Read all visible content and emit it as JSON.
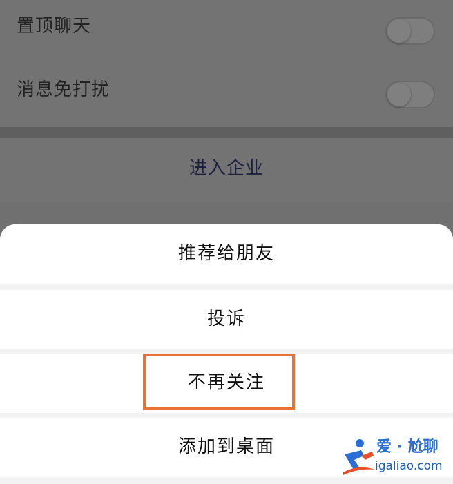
{
  "settings": {
    "pin_chat": {
      "label": "置顶聊天",
      "enabled": false
    },
    "mute_notifications": {
      "label": "消息免打扰",
      "enabled": false
    }
  },
  "enterprise": {
    "label": "进入企业"
  },
  "action_sheet": {
    "items": [
      {
        "label": "推荐给朋友"
      },
      {
        "label": "投诉"
      },
      {
        "label": "不再关注",
        "highlighted": true
      },
      {
        "label": "添加到桌面"
      }
    ]
  },
  "watermark": {
    "title": "爱 · 尬聊",
    "url": "igaliao.com"
  },
  "colors": {
    "overlay_background": "#707070",
    "sheet_background": "#ffffff",
    "highlight_border": "#e87235",
    "watermark_blue": "#2a6fd6"
  }
}
